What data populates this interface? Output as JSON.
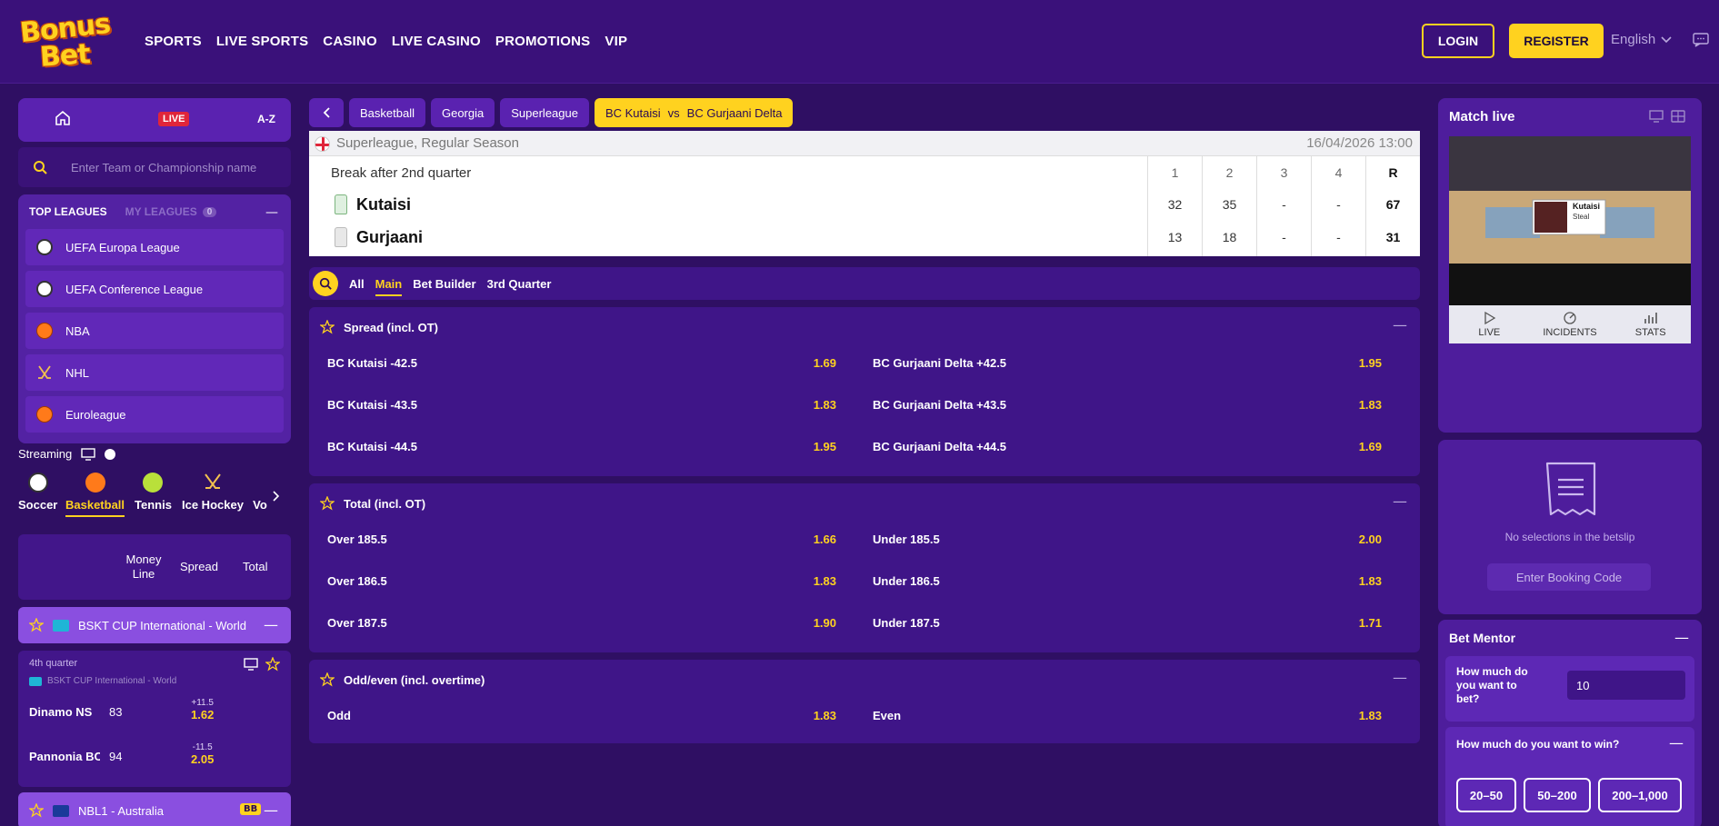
{
  "brand": {
    "logo_line1": "Bonus",
    "logo_line2": "Bet",
    "accent": "#ffd21f",
    "bg": "#2f0f63"
  },
  "nav": [
    "SPORTS",
    "LIVE SPORTS",
    "CASINO",
    "LIVE CASINO",
    "PROMOTIONS",
    "VIP"
  ],
  "header": {
    "login": "LOGIN",
    "register": "REGISTER",
    "language": "English"
  },
  "sidebar": {
    "live_badge": "LIVE",
    "az": "A-Z",
    "search_placeholder": "Enter Team or Championship name",
    "top_leagues": "TOP LEAGUES",
    "my_leagues": "MY LEAGUES",
    "my_leagues_count": "0",
    "leagues": [
      {
        "label": "UEFA Europa League",
        "icon": "soccer-icon"
      },
      {
        "label": "UEFA Conference League",
        "icon": "soccer-icon"
      },
      {
        "label": "NBA",
        "icon": "basketball-icon"
      },
      {
        "label": "NHL",
        "icon": "hockey-icon"
      },
      {
        "label": "Euroleague",
        "icon": "basketball-icon"
      }
    ],
    "streaming": "Streaming",
    "sports": [
      "Soccer",
      "Basketball",
      "Tennis",
      "Ice Hockey",
      "Vo"
    ],
    "active_sport": "Basketball",
    "market_tabs": [
      "Money Line",
      "Spread",
      "Total"
    ],
    "cup": "BSKT CUP International - World",
    "match": {
      "period": "4th quarter",
      "competition": "BSKT CUP International - World",
      "home": "Dinamo NS",
      "home_score": "83",
      "home_hcp": "+11.5",
      "home_odd": "1.62",
      "away": "Pannonia BC",
      "away_score": "94",
      "away_hcp": "-11.5",
      "away_odd": "2.05"
    },
    "nbl": "NBL1 - Australia",
    "nbl_badge": "BB"
  },
  "breadcrumbs": [
    "Basketball",
    "Georgia",
    "Superleague"
  ],
  "event": {
    "home": "BC Kutaisi",
    "vs": "vs",
    "away": "BC Gurjaani Delta"
  },
  "scoreboard": {
    "competition": "Superleague, Regular Season",
    "date": "16/04/2026 13:00",
    "status": "Break after 2nd quarter",
    "headers": [
      "1",
      "2",
      "3",
      "4",
      "R"
    ],
    "home": {
      "name": "Kutaisi",
      "scores": [
        "32",
        "35",
        "-",
        "-",
        "67"
      ]
    },
    "away": {
      "name": "Gurjaani",
      "scores": [
        "13",
        "18",
        "-",
        "-",
        "31"
      ]
    }
  },
  "filters": [
    "All",
    "Main",
    "Bet Builder",
    "3rd Quarter"
  ],
  "active_filter": "Main",
  "markets": [
    {
      "title": "Spread (incl. OT)",
      "rows": [
        {
          "l": "BC Kutaisi -42.5",
          "lo": "1.69",
          "r": "BC Gurjaani Delta +42.5",
          "ro": "1.95"
        },
        {
          "l": "BC Kutaisi -43.5",
          "lo": "1.83",
          "r": "BC Gurjaani Delta +43.5",
          "ro": "1.83"
        },
        {
          "l": "BC Kutaisi -44.5",
          "lo": "1.95",
          "r": "BC Gurjaani Delta +44.5",
          "ro": "1.69"
        }
      ]
    },
    {
      "title": "Total (incl. OT)",
      "rows": [
        {
          "l": "Over 185.5",
          "lo": "1.66",
          "r": "Under 185.5",
          "ro": "2.00"
        },
        {
          "l": "Over 186.5",
          "lo": "1.83",
          "r": "Under 186.5",
          "ro": "1.83"
        },
        {
          "l": "Over 187.5",
          "lo": "1.90",
          "r": "Under 187.5",
          "ro": "1.71"
        }
      ]
    },
    {
      "title": "Odd/even (incl. overtime)",
      "rows": [
        {
          "l": "Odd",
          "lo": "1.83",
          "r": "Even",
          "ro": "1.83"
        }
      ]
    }
  ],
  "right": {
    "match_live": "Match live",
    "video_overlay_team": "Kutaisi",
    "video_overlay_action": "Steal",
    "video_tabs": [
      "LIVE",
      "INCIDENTS",
      "STATS"
    ],
    "betslip_empty": "No selections in the betslip",
    "booking": "Enter Booking Code",
    "mentor_title": "Bet Mentor",
    "mentor_q1": "How much do you want to bet?",
    "mentor_value": "10",
    "mentor_q2": "How much do you want to win?",
    "chips": [
      "20–50",
      "50–200",
      "200–1,000"
    ]
  }
}
